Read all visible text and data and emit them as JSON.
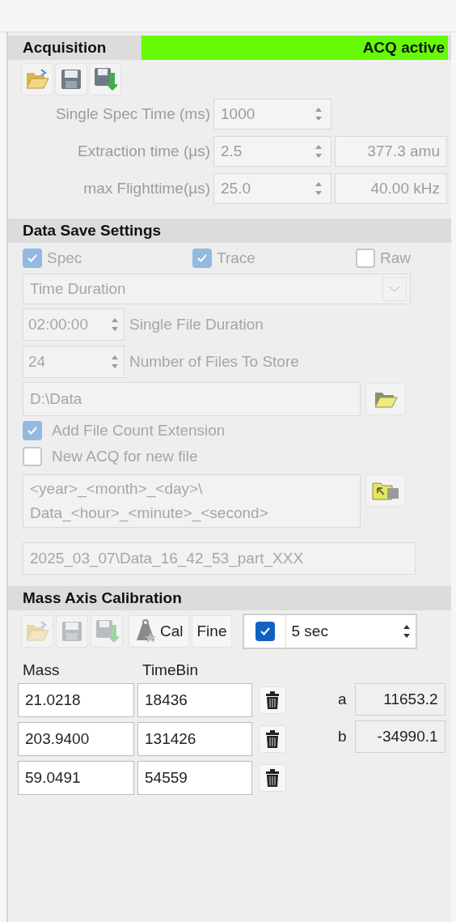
{
  "acquisition": {
    "title": "Acquisition",
    "status": {
      "text": "ACQ active",
      "active": true
    },
    "toolbar": [
      {
        "kind": "open",
        "disabled": false
      },
      {
        "kind": "save",
        "disabled": false
      },
      {
        "kind": "save_as",
        "disabled": false
      }
    ],
    "disabled": true,
    "fields": [
      {
        "label": "Single Spec Time (ms)",
        "value": "1000"
      },
      {
        "label": "Extraction time (µs)",
        "value": "2.5",
        "readout": "377.3 amu"
      },
      {
        "label": "max Flighttime(µs)",
        "value": "25.0",
        "readout": "40.00 kHz"
      }
    ]
  },
  "data_save_settings": {
    "title": "Data Save Settings",
    "disabled": true,
    "formats": [
      {
        "label": "Spec",
        "checked": true
      },
      {
        "label": "Trace",
        "checked": true
      },
      {
        "label": "Raw",
        "checked": false
      }
    ],
    "mode": {
      "value": "Time Duration"
    },
    "spins": [
      {
        "value": "02:00:00",
        "label": "Single File Duration"
      },
      {
        "value": "24",
        "label": "Number of Files To Store"
      }
    ],
    "folder": {
      "value": "D:\\Data"
    },
    "options": [
      {
        "label": "Add File Count Extension",
        "checked": true
      },
      {
        "label": "New ACQ for new file",
        "checked": false
      }
    ],
    "name_template": {
      "lines": [
        "<year>_<month>_<day>\\",
        "Data_<hour>_<minute>_<second>"
      ]
    },
    "preview": {
      "value": "2025_03_07\\Data_16_42_53_part_XXX"
    }
  },
  "mass_axis_calibration": {
    "title": "Mass Axis Calibration",
    "toolbar": [
      {
        "kind": "open",
        "disabled": true
      },
      {
        "kind": "save",
        "disabled": true
      },
      {
        "kind": "save_as",
        "disabled": true
      }
    ],
    "cal_button": {
      "label": "Cal",
      "disabled": false
    },
    "fine_button": {
      "label": "Fine",
      "disabled": false
    },
    "auto": {
      "checked": true,
      "value": "5 sec"
    },
    "columns": [
      "Mass",
      "TimeBin"
    ],
    "rows": [
      {
        "mass": "21.0218",
        "timebin": "18436"
      },
      {
        "mass": "203.9400",
        "timebin": "131426"
      },
      {
        "mass": "59.0491",
        "timebin": "54559"
      }
    ],
    "coefficients": [
      {
        "name": "a",
        "value": "11653.2"
      },
      {
        "name": "b",
        "value": "-34990.1"
      }
    ]
  }
}
